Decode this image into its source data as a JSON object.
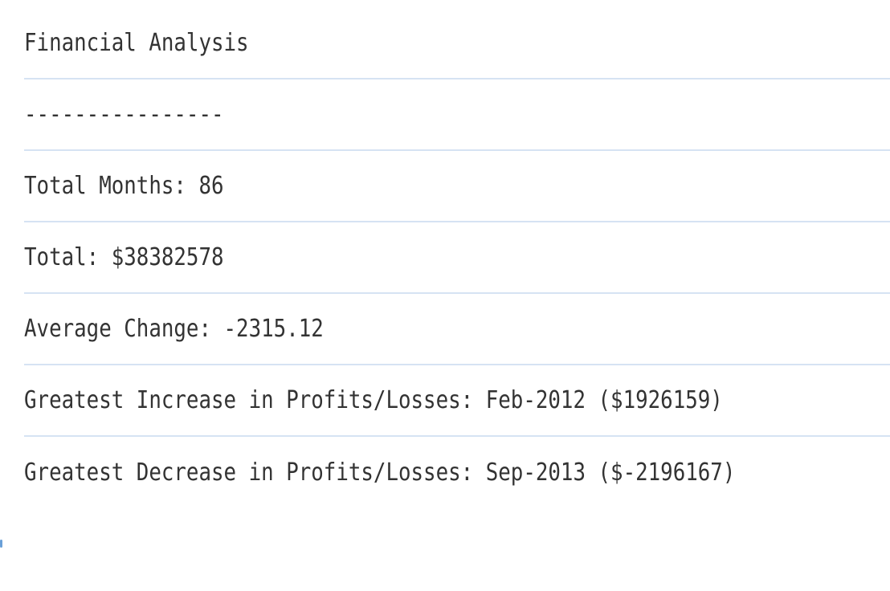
{
  "report": {
    "lines": [
      "Financial Analysis",
      "----------------",
      "Total Months: 86",
      "Total: $38382578",
      "Average Change: -2315.12",
      "Greatest Increase in Profits/Losses: Feb-2012 ($1926159)",
      "Greatest Decrease in Profits/Losses: Sep-2013 ($-2196167)"
    ]
  },
  "colors": {
    "text": "#333333",
    "divider": "#d6e3f3",
    "accent": "#6aa0d8"
  }
}
